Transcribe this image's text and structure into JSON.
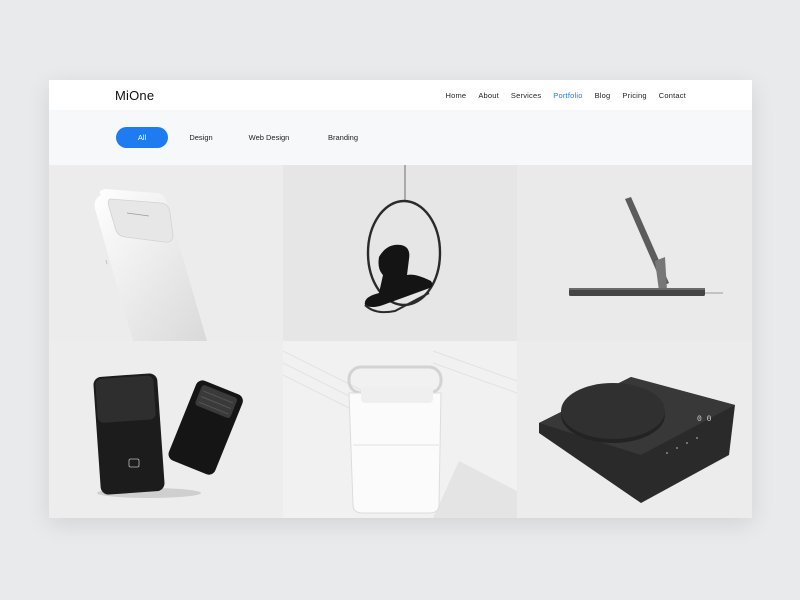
{
  "header": {
    "logo": "MiOne"
  },
  "nav": {
    "items": [
      {
        "label": "Home",
        "active": false
      },
      {
        "label": "About",
        "active": false
      },
      {
        "label": "Services",
        "active": false
      },
      {
        "label": "Portfolio",
        "active": true
      },
      {
        "label": "Blog",
        "active": false
      },
      {
        "label": "Pricing",
        "active": false
      },
      {
        "label": "Contact",
        "active": false
      }
    ]
  },
  "filters": {
    "items": [
      {
        "label": "All",
        "active": true
      },
      {
        "label": "Design",
        "active": false
      },
      {
        "label": "Web Design",
        "active": false
      },
      {
        "label": "Branding",
        "active": false
      }
    ]
  },
  "portfolio": {
    "items": [
      {
        "subject": "white-power-bank"
      },
      {
        "subject": "hanging-bubble-chair"
      },
      {
        "subject": "laptop-stand"
      },
      {
        "subject": "black-electric-shaver"
      },
      {
        "subject": "white-humidifier"
      },
      {
        "subject": "black-kitchen-scale"
      }
    ]
  },
  "colors": {
    "accent": "#1e7bf0",
    "text": "#222222",
    "page_bg": "#e9eaec",
    "filter_bg": "#f6f8fa"
  }
}
